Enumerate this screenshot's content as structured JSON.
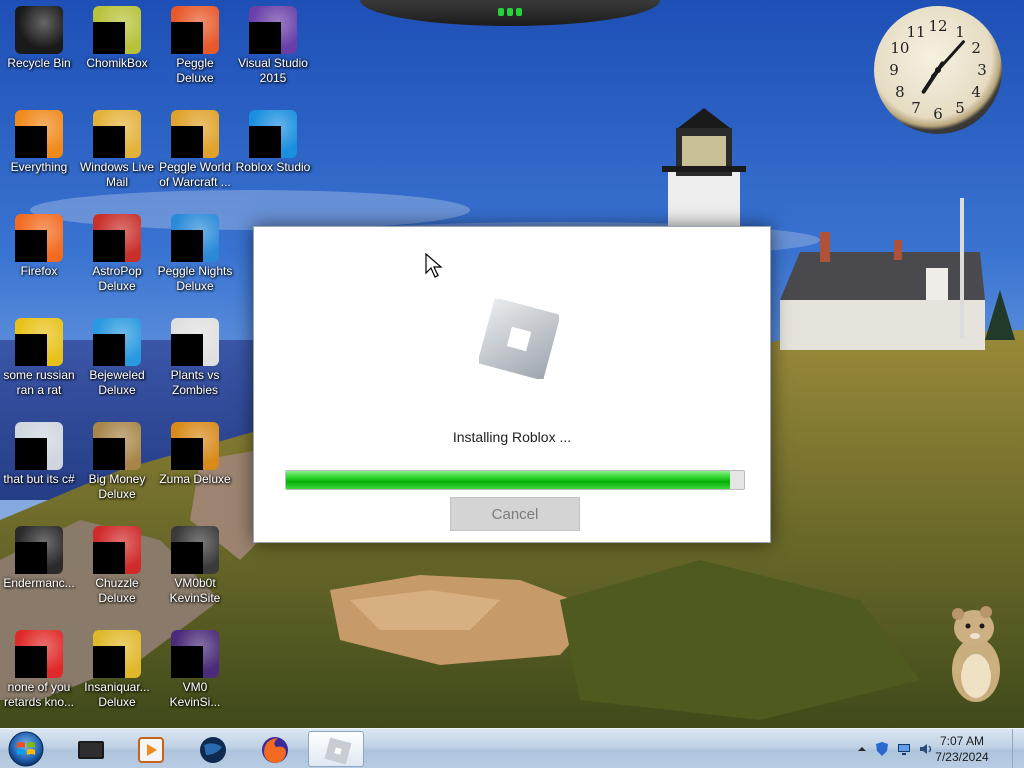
{
  "desktop": {
    "icons": [
      {
        "label": "Recycle Bin",
        "icon": "recycle-bin-icon",
        "color": "#1a1a1a"
      },
      {
        "label": "ChomikBox",
        "icon": "chomikbox-icon",
        "color": "#b8c23a"
      },
      {
        "label": "Peggle Deluxe",
        "icon": "peggle-deluxe-icon",
        "color": "#e8592a"
      },
      {
        "label": "Visual Studio 2015",
        "icon": "visual-studio-icon",
        "color": "#6a3fa8"
      },
      {
        "label": "Everything",
        "icon": "everything-icon",
        "color": "#f08a1c"
      },
      {
        "label": "Windows Live Mail",
        "icon": "windows-live-mail-icon",
        "color": "#e4b23a"
      },
      {
        "label": "Peggle World of Warcraft ...",
        "icon": "peggle-wow-icon",
        "color": "#e0a22a"
      },
      {
        "label": "Roblox Studio",
        "icon": "roblox-studio-icon",
        "color": "#1a8fe0"
      },
      {
        "label": "Firefox",
        "icon": "firefox-icon",
        "color": "#f26b21"
      },
      {
        "label": "AstroPop Deluxe",
        "icon": "astropop-icon",
        "color": "#c8302a"
      },
      {
        "label": "Peggle Nights Deluxe",
        "icon": "peggle-nights-icon",
        "color": "#2a8ad8"
      },
      {
        "label": "some russian ran a rat",
        "icon": "document-icon",
        "color": "#e8c21a"
      },
      {
        "label": "Bejeweled Deluxe",
        "icon": "bejeweled-icon",
        "color": "#2a9ae0"
      },
      {
        "label": "Plants vs Zombies",
        "icon": "plants-vs-zombies-icon",
        "color": "#e0e0e0"
      },
      {
        "label": "that but its c#",
        "icon": "copy-files-icon",
        "color": "#cfd6de"
      },
      {
        "label": "Big Money Deluxe",
        "icon": "big-money-icon",
        "color": "#a8864a"
      },
      {
        "label": "Zuma Deluxe",
        "icon": "zuma-icon",
        "color": "#d88a1a"
      },
      {
        "label": "Endermanc...",
        "icon": "terminal-icon",
        "color": "#2a2a2a"
      },
      {
        "label": "Chuzzle Deluxe",
        "icon": "chuzzle-icon",
        "color": "#d02a2a"
      },
      {
        "label": "VM0b0t KevinSite",
        "icon": "vm-bot-icon",
        "color": "#3a3a3a"
      },
      {
        "label": "none of you retards kno...",
        "icon": "opera-icon",
        "color": "#e02a2a"
      },
      {
        "label": "Insaniquar... Deluxe",
        "icon": "insaniquarium-icon",
        "color": "#e0b82a"
      },
      {
        "label": "VM0 KevinSi...",
        "icon": "vm-icon",
        "color": "#4a2a7a"
      }
    ]
  },
  "clock": {
    "numerals": [
      "12",
      "1",
      "2",
      "3",
      "4",
      "5",
      "6",
      "7",
      "8",
      "9",
      "10",
      "11"
    ],
    "time": "7:07"
  },
  "installer": {
    "status": "Installing Roblox ...",
    "progress": 0.97,
    "cancel_label": "Cancel",
    "accent": "#06b006"
  },
  "taskbar": {
    "start_icon": "windows-start-orb-icon",
    "apps": [
      {
        "icon": "terminal-icon"
      },
      {
        "icon": "media-player-icon"
      },
      {
        "icon": "globe-icon"
      },
      {
        "icon": "firefox-icon"
      },
      {
        "icon": "roblox-icon"
      }
    ],
    "tray": {
      "time": "7:07 AM",
      "date": "7/23/2024"
    }
  }
}
